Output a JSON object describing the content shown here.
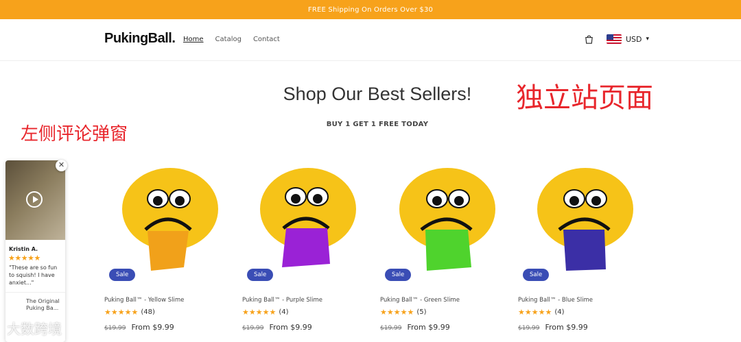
{
  "announcement": "FREE Shipping On Orders Over $30",
  "header": {
    "logo": "PukingBall.",
    "nav": [
      "Home",
      "Catalog",
      "Contact"
    ],
    "currency": "USD"
  },
  "hero": {
    "title": "Shop Our Best Sellers!",
    "subtitle": "BUY 1 GET 1 FREE TODAY"
  },
  "annotations": {
    "right": "独立站页面",
    "left": "左侧评论弹窗"
  },
  "products": [
    {
      "name": "Puking Ball™ - Yellow Slime",
      "reviews": "(48)",
      "old_price": "$19.99",
      "price": "From $9.99",
      "badge": "Sale",
      "slime": "#f1a11a"
    },
    {
      "name": "Puking Ball™ - Purple Slime",
      "reviews": "(4)",
      "old_price": "$19.99",
      "price": "From $9.99",
      "badge": "Sale",
      "slime": "#9a22d6"
    },
    {
      "name": "Puking Ball™ - Green Slime",
      "reviews": "(5)",
      "old_price": "$19.99",
      "price": "From $9.99",
      "badge": "Sale",
      "slime": "#4fd32d"
    },
    {
      "name": "Puking Ball™ - Blue Slime",
      "reviews": "(4)",
      "old_price": "$19.99",
      "price": "From $9.99",
      "badge": "Sale",
      "slime": "#3b2fa6"
    }
  ],
  "review_popup": {
    "name": "Kristin A.",
    "stars": "★★★★★",
    "text": "\"These are so fun to squish! I have anxiet...\"",
    "product": "The Original Puking Ba..."
  },
  "watermark": "大数跨境",
  "ratings_glyph": "★★★★★"
}
